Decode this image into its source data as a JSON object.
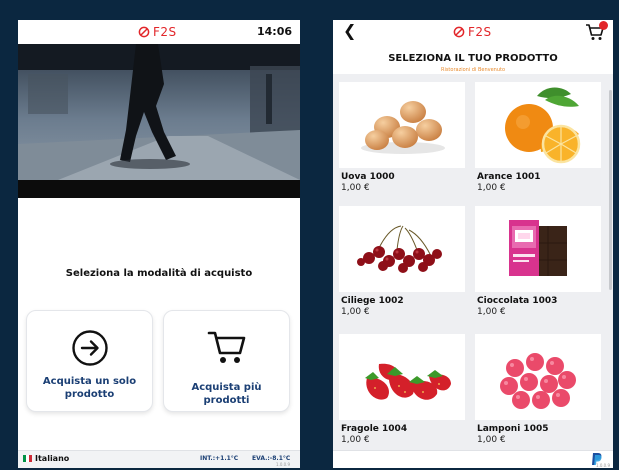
{
  "left_screen": {
    "logo_text": "F2S",
    "clock": "14:06",
    "prompt": "Seleziona la modalità di acquisto",
    "option_single": "Acquista un solo prodotto",
    "option_multi": "Acquista più prodotti",
    "language": "Italiano",
    "temp_int": "INT.:+1.1°C",
    "temp_eva": "EVA.:-8.1°C",
    "version": "1.0.0.9"
  },
  "right_screen": {
    "logo_text": "F2S",
    "title": "SELEZIONA IL TUO PRODOTTO",
    "subtitle": "Ristorazioni di Benvenuto",
    "products": [
      {
        "name": "Uova 1000",
        "price": "1,00 €"
      },
      {
        "name": "Arance 1001",
        "price": "1,00 €"
      },
      {
        "name": "Ciliege 1002",
        "price": "1,00 €"
      },
      {
        "name": "Cioccolata 1003",
        "price": "1,00 €"
      },
      {
        "name": "Fragole 1004",
        "price": "1,00 €"
      },
      {
        "name": "Lamponi 1005",
        "price": "1,00 €"
      }
    ],
    "version": "1.0.0.9"
  },
  "colors": {
    "background": "#0b2740",
    "brand_red": "#e2262a",
    "label_blue": "#1b3f74",
    "subtitle_orange": "#e88a2c"
  },
  "icons": [
    "f2s-logo-icon",
    "arrow-right-circle-icon",
    "cart-icon",
    "back-chevron-icon",
    "italian-flag-icon",
    "paypal-icon"
  ]
}
